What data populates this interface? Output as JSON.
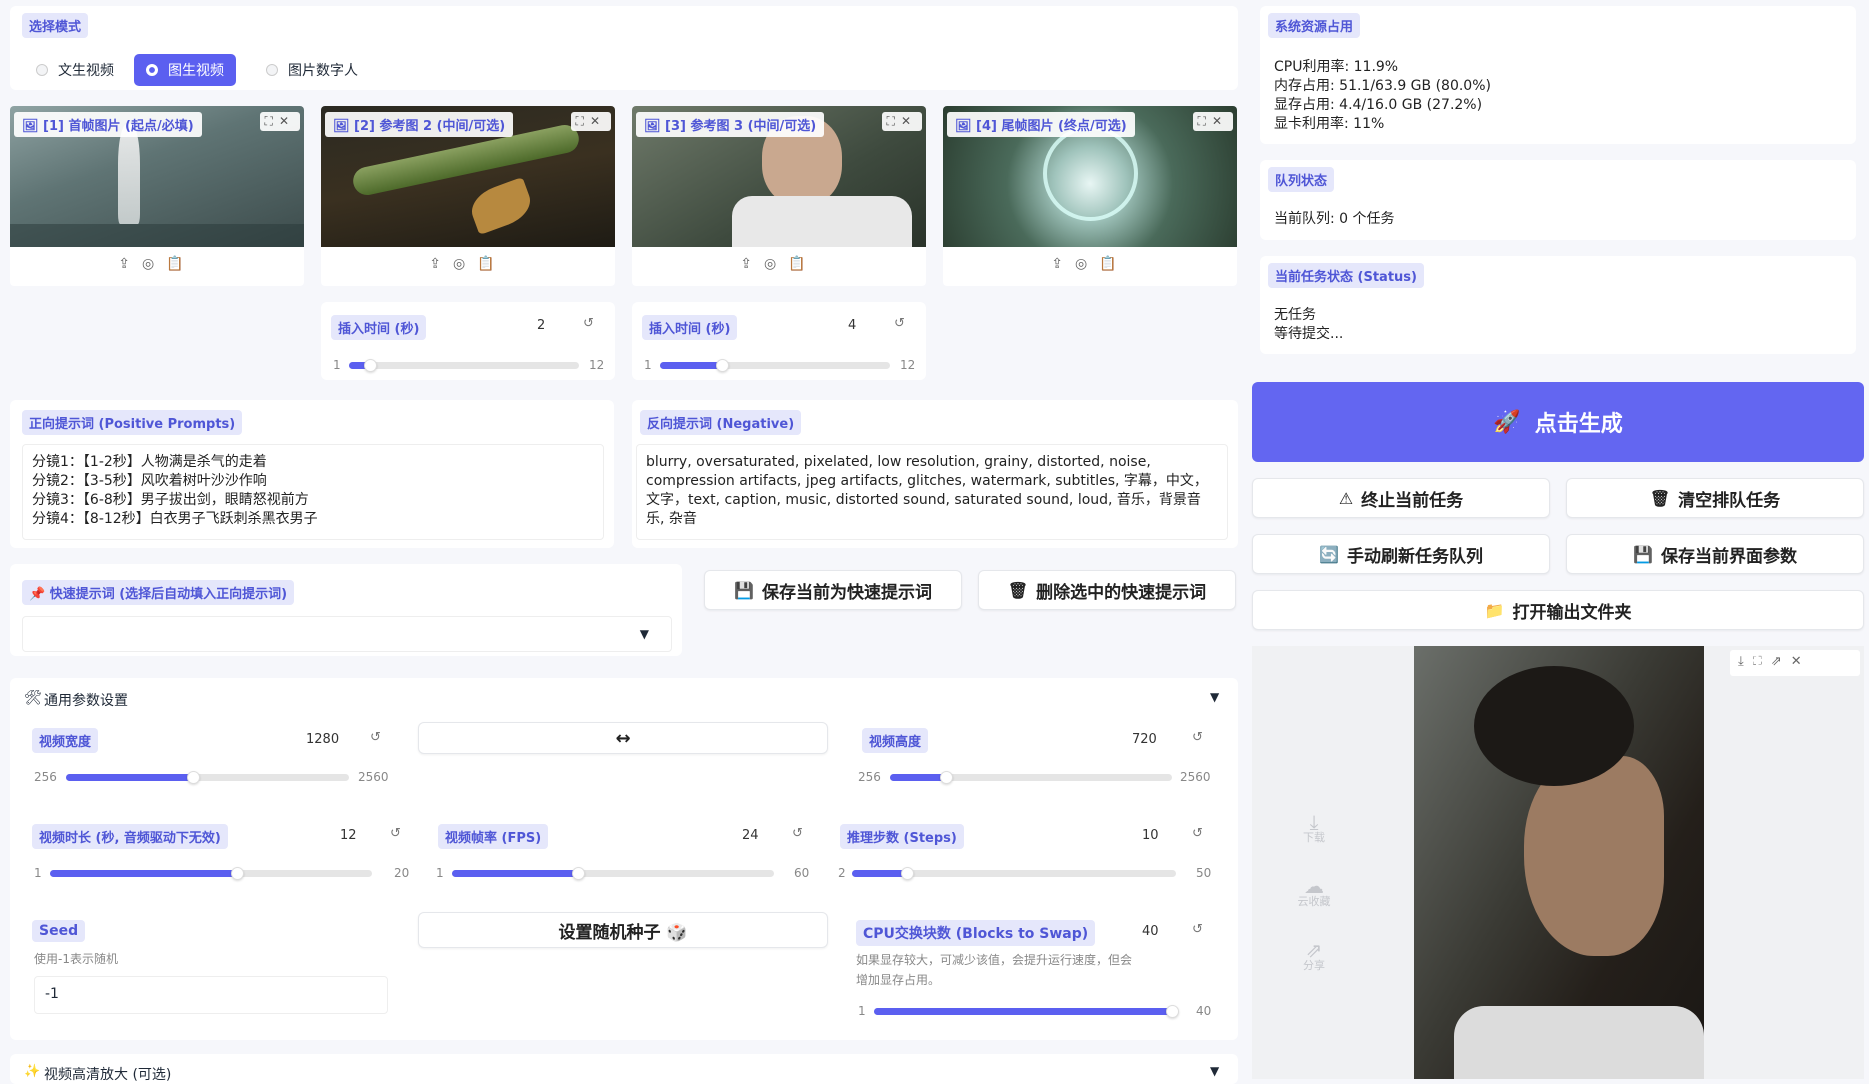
{
  "mode": {
    "label": "选择模式",
    "options": [
      "文生视频",
      "图生视频",
      "图片数字人"
    ],
    "selected": 1
  },
  "images": [
    {
      "label": "[1] 首帧图片 (起点/必填)"
    },
    {
      "label": "[2] 参考图 2 (中间/可选)"
    },
    {
      "label": "[3] 参考图 3 (中间/可选)"
    },
    {
      "label": "[4] 尾帧图片 (终点/可选)"
    }
  ],
  "insert_sliders": [
    {
      "label": "插入时间 (秒)",
      "value": "2",
      "min": "1",
      "max": "12",
      "fraction": 0.09
    },
    {
      "label": "插入时间 (秒)",
      "value": "4",
      "min": "1",
      "max": "12",
      "fraction": 0.27
    }
  ],
  "positive": {
    "label": "正向提示词 (Positive Prompts)",
    "text": "分镜1：【1-2秒】人物满是杀气的走着\n分镜2：【3-5秒】风吹着树叶沙沙作响\n分镜3：【6-8秒】男子拔出剑，眼睛怒视前方\n分镜4：【8-12秒】白衣男子飞跃刺杀黑衣男子"
  },
  "negative": {
    "label": "反向提示词 (Negative)",
    "text": "blurry, oversaturated, pixelated, low resolution, grainy, distorted, noise, compression artifacts, jpeg artifacts, glitches, watermark, subtitles, 字幕，中文，文字，text, caption, music, distorted sound, saturated sound, loud, 音乐，背景音乐, 杂音"
  },
  "quick": {
    "label": "快速提示词 (选择后自动填入正向提示词)",
    "save": "保存当前为快速提示词",
    "delete": "删除选中的快速提示词"
  },
  "general": {
    "title": "通用参数设置",
    "swap_label": "↔",
    "seed_button": "设置随机种子 🎲"
  },
  "params": {
    "width": {
      "label": "视频宽度",
      "value": "1280",
      "min": "256",
      "max": "2560",
      "fraction": 0.45
    },
    "height": {
      "label": "视频高度",
      "value": "720",
      "min": "256",
      "max": "2560",
      "fraction": 0.2
    },
    "duration": {
      "label": "视频时长 (秒, 音频驱动下无效)",
      "value": "12",
      "min": "1",
      "max": "20",
      "fraction": 0.58
    },
    "fps": {
      "label": "视频帧率 (FPS)",
      "value": "24",
      "min": "1",
      "max": "60",
      "fraction": 0.39
    },
    "steps": {
      "label": "推理步数 (Steps)",
      "value": "10",
      "min": "2",
      "max": "50",
      "fraction": 0.17
    },
    "seed": {
      "label": "Seed",
      "hint": "使用-1表示随机",
      "value": "-1"
    },
    "swap": {
      "label": "CPU交换块数 (Blocks to Swap)",
      "value": "40",
      "hint": "如果显存较大，可减少该值，会提升运行速度，但会增加显存占用。",
      "min": "1",
      "max": "40",
      "fraction": 1.0
    }
  },
  "upscale": {
    "title": "视频高清放大 (可选)"
  },
  "resources": {
    "label": "系统资源占用",
    "lines": [
      "CPU利用率: 11.9%",
      "内存占用: 51.1/63.9 GB (80.0%)",
      "显存占用: 4.4/16.0 GB (27.2%)",
      "显卡利用率: 11%"
    ]
  },
  "queue": {
    "label": "队列状态",
    "text": "当前队列: 0 个任务"
  },
  "task": {
    "label": "当前任务状态 (Status)",
    "lines": [
      "无任务",
      "等待提交..."
    ]
  },
  "actions": {
    "generate": "点击生成",
    "stop": "终止当前任务",
    "clear": "清空排队任务",
    "refresh": "手动刷新任务队列",
    "save_params": "保存当前界面参数",
    "open_folder": "打开输出文件夹"
  },
  "video_side": {
    "items": [
      "下载",
      "云收藏",
      "分享"
    ]
  },
  "colors": {
    "accent": "#5b5ff0",
    "tag_bg": "#e5e7fb"
  }
}
